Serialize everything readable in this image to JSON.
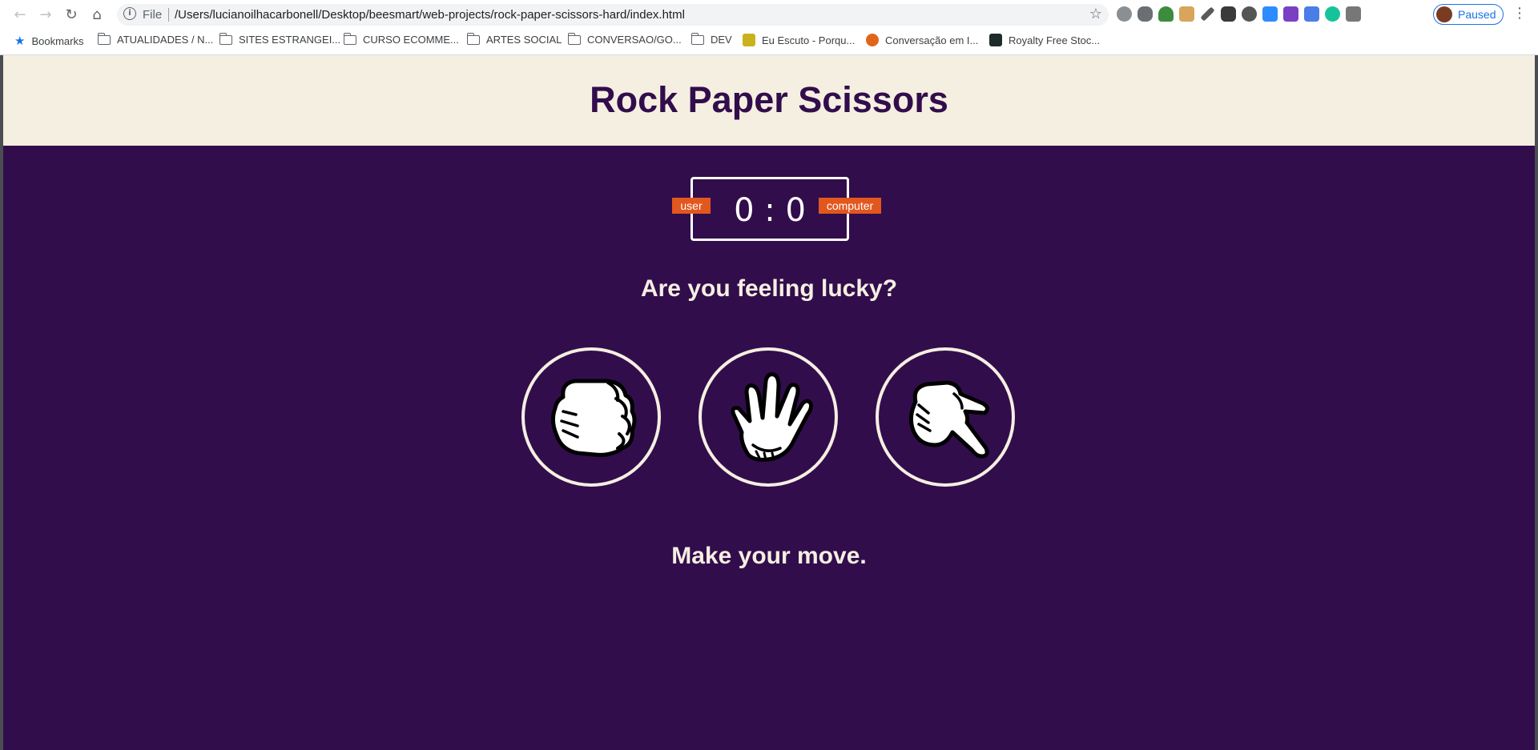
{
  "browser": {
    "omnibox_scheme": "File",
    "url": "/Users/lucianoilhacarbonell/Desktop/beesmart/web-projects/rock-paper-scissors-hard/index.html",
    "profile_label": "Paused",
    "extension_icons": [
      "extension-1-icon",
      "extension-2-icon",
      "extension-3-icon",
      "extension-4-icon",
      "eyedropper-icon",
      "extension-6-icon",
      "extension-7-icon",
      "zoom-icon",
      "extension-9-icon",
      "translate-icon",
      "grammarly-icon",
      "extension-12-icon"
    ],
    "bookmarks": [
      {
        "label": "Bookmarks",
        "icon": "star"
      },
      {
        "label": "ATUALIDADES / N...",
        "icon": "folder"
      },
      {
        "label": "SITES ESTRANGEI...",
        "icon": "folder"
      },
      {
        "label": "CURSO ECOMME...",
        "icon": "folder"
      },
      {
        "label": "ARTES SOCIAL",
        "icon": "folder"
      },
      {
        "label": "CONVERSAO/GO...",
        "icon": "folder"
      },
      {
        "label": "DEV",
        "icon": "folder"
      },
      {
        "label": "Eu Escuto - Porqu...",
        "icon": "favicon"
      },
      {
        "label": "Conversação em I...",
        "icon": "favicon"
      },
      {
        "label": "Royalty Free Stoc...",
        "icon": "favicon"
      }
    ]
  },
  "game": {
    "title": "Rock Paper Scissors",
    "score_user": "0",
    "score_computer": "0",
    "score_separator": ":",
    "user_label": "user",
    "computer_label": "computer",
    "question": "Are you feeling lucky?",
    "choices": [
      {
        "name": "rock",
        "icon": "rock-hand-icon"
      },
      {
        "name": "paper",
        "icon": "paper-hand-icon"
      },
      {
        "name": "scissors",
        "icon": "scissors-hand-icon"
      }
    ],
    "message": "Make your move."
  },
  "colors": {
    "page_background": "#320d4c",
    "header_background": "#f5efe1",
    "badge": "#e2571e",
    "text_light": "#f5efe1"
  }
}
